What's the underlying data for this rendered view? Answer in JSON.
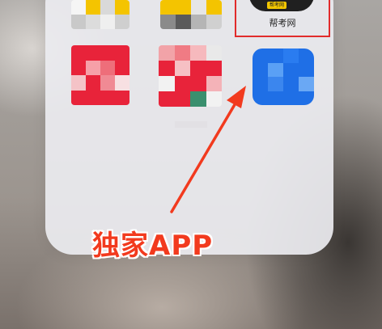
{
  "folder": {
    "highlighted_app": {
      "icon_tag": "帮考网",
      "name": "帮考网"
    }
  },
  "annotation": {
    "callout_text": "独家APP",
    "accent_color": "#f23a1e",
    "highlight_color": "#e12b2b"
  },
  "blurred_icons": [
    {
      "name": "blurred-app-1",
      "palette": [
        "#f5f5f5",
        "#f4c400",
        "#d9d9d9",
        "#f4c400",
        "#c9c9c9",
        "#dcdcdc",
        "#efefef",
        "#cfcfcf"
      ]
    },
    {
      "name": "blurred-app-2",
      "palette": [
        "#f4c400",
        "#f4c400",
        "#e6e6e6",
        "#f4c400",
        "#8a8a8a",
        "#5a5a5a",
        "#b5b5b5",
        "#d0d0d0"
      ]
    },
    {
      "name": "blurred-app-3",
      "palette": [
        "#e8233a",
        "#e8233a",
        "#e8233a",
        "#e8233a",
        "#e8233a",
        "#f6a0a8",
        "#ee6e7a",
        "#e8233a",
        "#f4c3c7",
        "#e8233a",
        "#f08a94",
        "#f7e0e2",
        "#e8233a",
        "#e8233a",
        "#e8233a",
        "#e8233a"
      ]
    },
    {
      "name": "blurred-app-4",
      "palette": [
        "#f2a3a8",
        "#f07b84",
        "#f6b9bd",
        "#e9e9e9",
        "#e8233a",
        "#f6c0c4",
        "#e8233a",
        "#e8233a",
        "#f2f2f2",
        "#e8233a",
        "#e8233a",
        "#f4b3b8",
        "#e8233a",
        "#e8233a",
        "#3a8f6e",
        "#f2f2f2"
      ]
    },
    {
      "name": "blurred-app-5",
      "palette": [
        "#1f6fe6",
        "#1f6fe6",
        "#2a7cf0",
        "#1f6fe6",
        "#1f6fe6",
        "#5aa0f5",
        "#1f6fe6",
        "#1f6fe6",
        "#1f6fe6",
        "#3b86ee",
        "#1f6fe6",
        "#6aa8f4",
        "#1f6fe6",
        "#1f6fe6",
        "#1f6fe6",
        "#1f6fe6"
      ]
    }
  ]
}
